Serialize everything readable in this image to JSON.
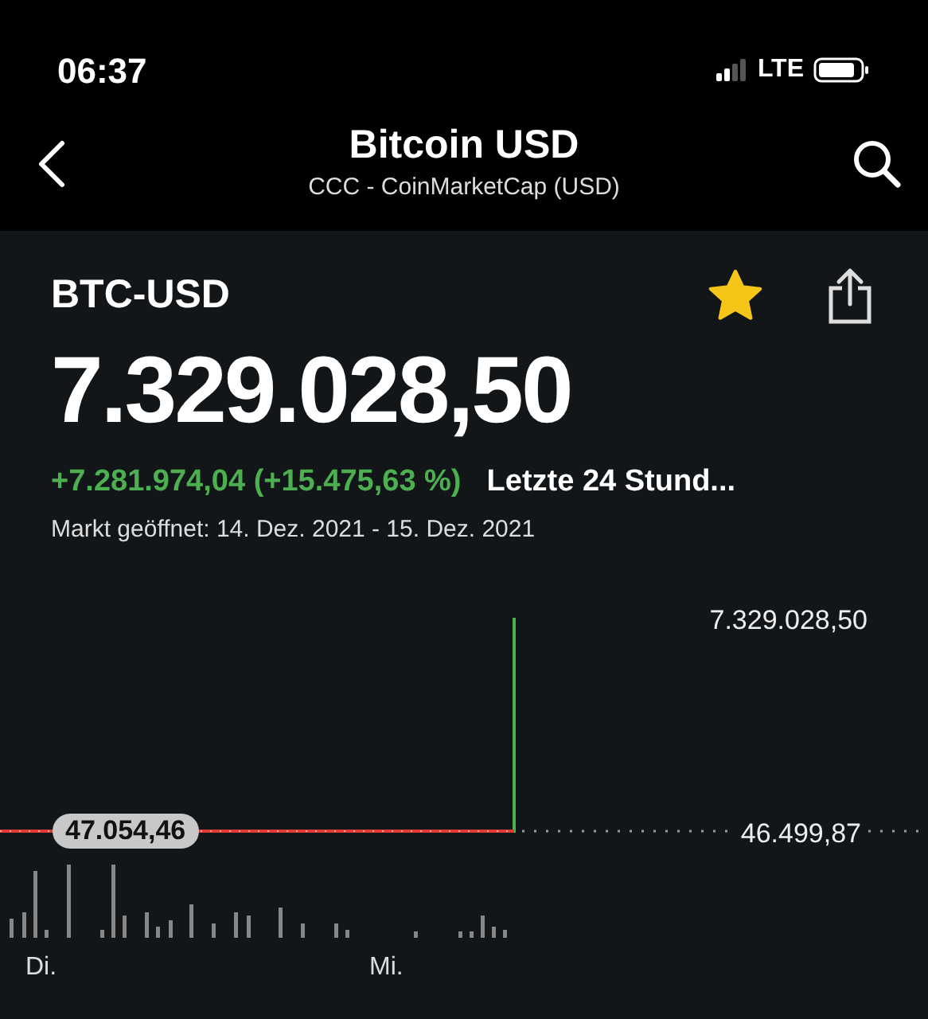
{
  "status_bar": {
    "time": "06:37",
    "network": "LTE"
  },
  "header": {
    "title": "Bitcoin USD",
    "subtitle": "CCC - CoinMarketCap (USD)"
  },
  "quote": {
    "symbol": "BTC-USD",
    "favorite": true,
    "price": "7.329.028,50",
    "change": "+7.281.974,04 (+15.475,63 %)",
    "period": "Letzte 24 Stund...",
    "market_status": "Markt geöffnet: 14. Dez. 2021 - 15. Dez. 2021"
  },
  "chart": {
    "high_label": "7.329.028,50",
    "previous_close_label": "46.499,87",
    "start_price_label": "47.054,46",
    "x_labels": [
      "Di.",
      "Mi."
    ]
  }
}
